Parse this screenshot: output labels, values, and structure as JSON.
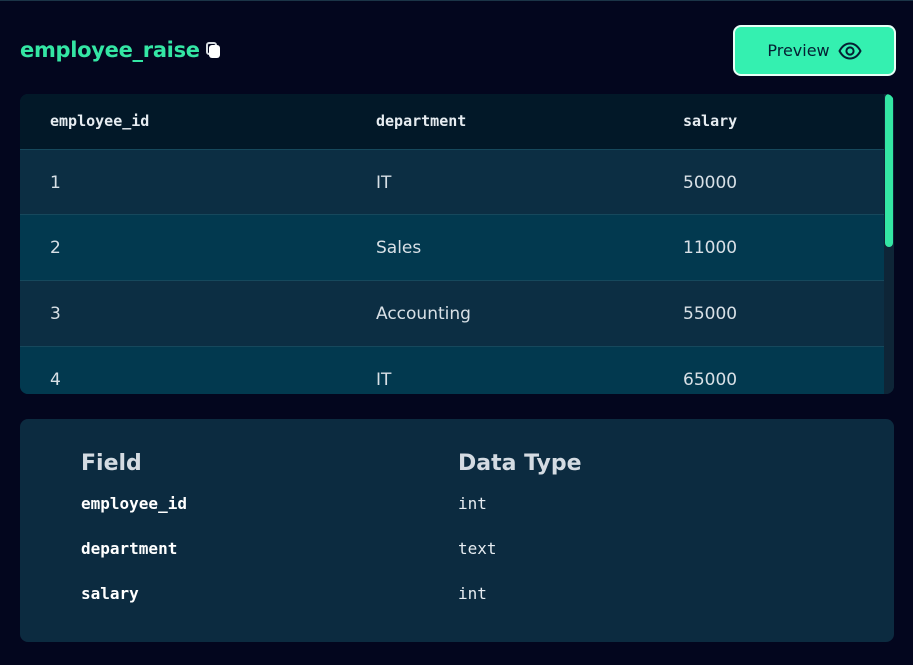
{
  "title": "employee_raise",
  "preview_label": "Preview",
  "colors": {
    "accent": "#34e6a4",
    "button_bg": "#34f0b0",
    "background": "#03061e"
  },
  "table": {
    "columns": [
      "employee_id",
      "department",
      "salary"
    ],
    "rows": [
      [
        "1",
        "IT",
        "50000"
      ],
      [
        "2",
        "Sales",
        "11000"
      ],
      [
        "3",
        "Accounting",
        "55000"
      ],
      [
        "4",
        "IT",
        "65000"
      ]
    ]
  },
  "schema": {
    "headers": [
      "Field",
      "Data Type"
    ],
    "fields": [
      {
        "name": "employee_id",
        "type": "int"
      },
      {
        "name": "department",
        "type": "text"
      },
      {
        "name": "salary",
        "type": "int"
      }
    ]
  },
  "icons": [
    "copy-icon",
    "eye-icon"
  ]
}
